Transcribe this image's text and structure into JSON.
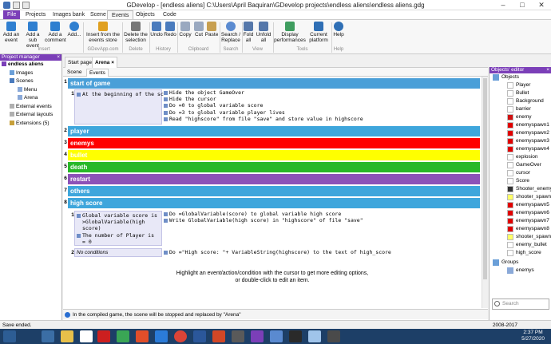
{
  "window": {
    "title": "GDevelop - [endless aliens] C:\\Users\\April Baquiran\\GDevelop projects\\endless aliens\\endless aliens.gdg"
  },
  "menu": {
    "tabs": [
      "File",
      "Projects",
      "Images bank",
      "Scene",
      "Events",
      "Objects",
      "Code"
    ]
  },
  "ribbon": {
    "buttons": [
      {
        "label": "Add an event"
      },
      {
        "label": "Add a sub event"
      },
      {
        "label": "Add a comment"
      },
      {
        "label": "Add..."
      },
      {
        "label": "Insert from the events store"
      },
      {
        "label": "Delete the selection"
      },
      {
        "label": "Undo"
      },
      {
        "label": "Redo"
      },
      {
        "label": "Copy"
      },
      {
        "label": "Cut"
      },
      {
        "label": "Paste"
      },
      {
        "label": "Search / Replace"
      },
      {
        "label": "Fold all"
      },
      {
        "label": "Unfold all"
      },
      {
        "label": "Display performances"
      },
      {
        "label": "Current platform"
      },
      {
        "label": "Help"
      }
    ],
    "groups": [
      "Insert",
      "GDevApp.com",
      "Delete",
      "History",
      "Clipboard",
      "Search",
      "View",
      "Tools",
      "Help"
    ]
  },
  "project_manager": {
    "title": "Project manager",
    "tree": [
      {
        "label": "endless aliens",
        "level": 0,
        "bold": true
      },
      {
        "label": "Images",
        "level": 1
      },
      {
        "label": "Scenes",
        "level": 1
      },
      {
        "label": "Menu",
        "level": 2
      },
      {
        "label": "Arena",
        "level": 2
      },
      {
        "label": "External events",
        "level": 1
      },
      {
        "label": "External layouts",
        "level": 1
      },
      {
        "label": "Extensions (5)",
        "level": 1
      }
    ]
  },
  "doc_tabs": [
    "Start page",
    "Arena"
  ],
  "sub_tabs": [
    "Scene",
    "Events"
  ],
  "events": {
    "groups": [
      {
        "num": "1",
        "label": "start of game",
        "color": "#4a9fd8"
      },
      {
        "num": "2",
        "label": "player",
        "color": "#3ea6dc"
      },
      {
        "num": "3",
        "label": "enemys",
        "color": "#ff0000"
      },
      {
        "num": "4",
        "label": "bullet",
        "color": "#ffff00"
      },
      {
        "num": "5",
        "label": "death",
        "color": "#28b828"
      },
      {
        "num": "6",
        "label": "restart",
        "color": "#8c52b8"
      },
      {
        "num": "7",
        "label": "others",
        "color": "#3ea6dc"
      },
      {
        "num": "8",
        "label": "high score",
        "color": "#3ea6dc"
      }
    ],
    "e1": {
      "num": "1",
      "condition": "At the beginning of the scene",
      "actions": [
        "Hide the object GameOver",
        "Hide the cursor",
        "Do =0 to global variable score",
        "Do =3 to global variable player lives",
        "Read \"highscore\" from file \"save\" and store value in highscore"
      ]
    },
    "e8_1": {
      "num": "1",
      "conditions": [
        "Global variable score is >GlobalVariable(high score)",
        "The number of Player is = 0"
      ],
      "actions": [
        "Do =GlobalVariable(score) to global variable high score",
        "Write GlobalVariable(high score) in \"highscore\" of file \"save\""
      ]
    },
    "e8_2": {
      "num": "2",
      "condition": "No conditions",
      "action": "Do =\"High score: \"+ VariableString(highscore) to the text of high_score"
    },
    "hint": [
      "Highlight an event/action/condition with the cursor to get more editing options,",
      "or double-click to edit an item."
    ]
  },
  "bottom_info": "In the compiled game, the scene will be stopped and replaced by \"Arena\"",
  "objects_editor": {
    "title": "Objects' editor",
    "root": "Objects",
    "objects": [
      {
        "name": "Player",
        "color": "#fff"
      },
      {
        "name": "Bullet",
        "color": "#fff"
      },
      {
        "name": "Background",
        "color": "#fff"
      },
      {
        "name": "barrier",
        "color": "#fff"
      },
      {
        "name": "enemy",
        "color": "#d01010"
      },
      {
        "name": "enemyspawn1",
        "color": "#e00000"
      },
      {
        "name": "enemyspawn2",
        "color": "#e00000"
      },
      {
        "name": "enemyspawn3",
        "color": "#e00000"
      },
      {
        "name": "enemyspawn4",
        "color": "#e00000"
      },
      {
        "name": "explosion",
        "color": "#fff"
      },
      {
        "name": "GameOver",
        "color": "#fff"
      },
      {
        "name": "cursor",
        "color": "#fff"
      },
      {
        "name": "Score",
        "color": "#fff"
      },
      {
        "name": "Shooter_enemy",
        "color": "#333"
      },
      {
        "name": "shooter_spawn",
        "color": "#ffff66"
      },
      {
        "name": "enemyspawn5",
        "color": "#e00000"
      },
      {
        "name": "enemyspawn6",
        "color": "#e00000"
      },
      {
        "name": "enemyspawn7",
        "color": "#e00000"
      },
      {
        "name": "enemyspawn8",
        "color": "#e00000"
      },
      {
        "name": "shooter_spawn2",
        "color": "#ffff66"
      },
      {
        "name": "enemy_bullet",
        "color": "#fff"
      },
      {
        "name": "high_score",
        "color": "#fff"
      }
    ],
    "groups_label": "Groups",
    "groups": [
      "enemys"
    ],
    "search_placeholder": "Search"
  },
  "status": {
    "left": "Save ended.",
    "right": "2008-2017"
  },
  "clock": {
    "time": "2:37 PM",
    "date": "5/27/2020"
  },
  "colors": {
    "accent": "#7b3fb8"
  }
}
